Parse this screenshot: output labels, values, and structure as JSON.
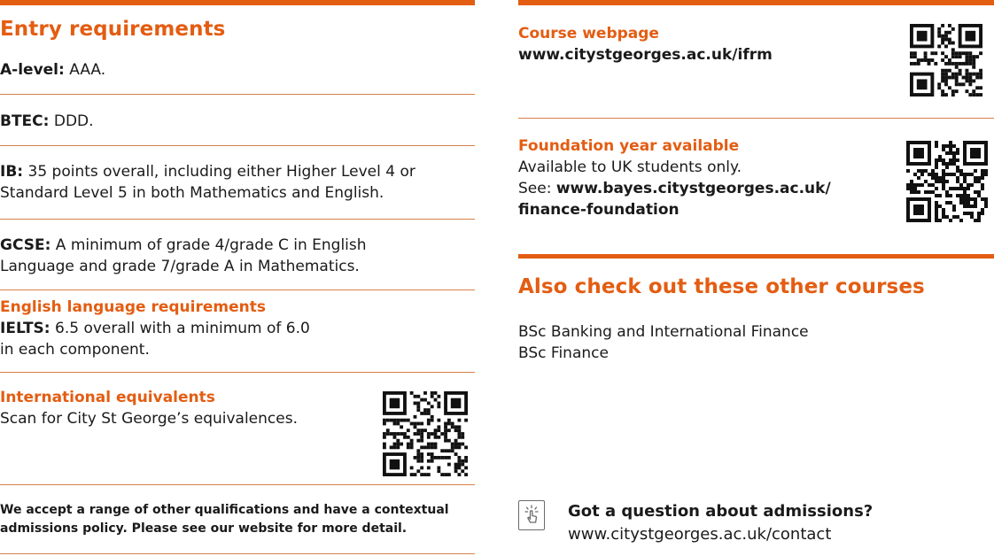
{
  "entry": {
    "title": "Entry requirements",
    "alevel_label": "A-level:",
    "alevel_value": " AAA.",
    "btec_label": "BTEC:",
    "btec_value": " DDD.",
    "ib_label": "IB:",
    "ib_line1": " 35 points overall, including either Higher Level 4 or",
    "ib_line2": "Standard Level 5 in both Mathematics and English.",
    "gcse_label": "GCSE:",
    "gcse_line1": " A minimum of grade 4/grade C in English",
    "gcse_line2": "Language and grade 7/grade A in Mathematics.",
    "english_heading": "English language requirements",
    "ielts_label": "IELTS:",
    "ielts_line1": " 6.5 overall with a minimum of 6.0",
    "ielts_line2": "in each component.",
    "intl_heading": "International equivalents",
    "intl_text": "Scan for City St George’s equivalences.",
    "note_line1": "We accept a range of other qualifications and have a contextual",
    "note_line2": "admissions policy. Please see our website for more detail."
  },
  "course": {
    "heading": "Course webpage",
    "url": "www.citystgeorges.ac.uk/ifrm"
  },
  "foundation": {
    "heading": "Foundation year available",
    "line1": "Available to UK students only.",
    "see_label": "See: ",
    "url_line1": "www.bayes.citystgeorges.ac.uk/",
    "url_line2": "finance-foundation"
  },
  "also": {
    "title": "Also check out these other courses",
    "courses": [
      "BSc Banking and International Finance",
      "BSc Finance"
    ]
  },
  "question": {
    "heading": "Got a question about admissions?",
    "url": "www.citystgeorges.ac.uk/contact",
    "icon": "touch-icon"
  },
  "colors": {
    "accent": "#e35d12"
  }
}
